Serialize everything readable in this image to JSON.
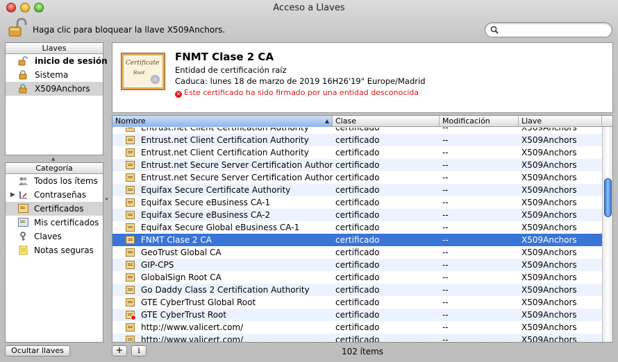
{
  "window": {
    "title": "Acceso a Llaves"
  },
  "toolbar": {
    "lock_text": "Haga clic para bloquear la llave X509Anchors.",
    "search_placeholder": ""
  },
  "keychains": {
    "header": "Llaves",
    "items": [
      {
        "label": "inicio de sesión",
        "icon": "unlocked-padlock-icon",
        "bold": true
      },
      {
        "label": "Sistema",
        "icon": "padlock-icon"
      },
      {
        "label": "X509Anchors",
        "icon": "padlock-icon",
        "selected": true
      }
    ]
  },
  "categories": {
    "header": "Categoría",
    "items": [
      {
        "label": "Todos los ítems",
        "icon": "people-icon"
      },
      {
        "label": "Contraseñas",
        "icon": "key-pen-icon",
        "expandable": true
      },
      {
        "label": "Certificados",
        "icon": "certificate-icon",
        "selected": true
      },
      {
        "label": "Mis certificados",
        "icon": "my-certificate-icon"
      },
      {
        "label": "Claves",
        "icon": "key-icon"
      },
      {
        "label": "Notas seguras",
        "icon": "note-icon"
      }
    ]
  },
  "detail": {
    "title": "FNMT Clase 2 CA",
    "subtitle": "Entidad de certificación raíz",
    "expires": "Caduca: lunes 18 de marzo de 2019 16H26'19\" Europe/Madrid",
    "error": "Este certificado ha sido firmado por una entidad desconocida",
    "thumb_word": "Certificate",
    "thumb_root": "Root"
  },
  "table": {
    "columns": [
      "Nombre",
      "Clase",
      "Modificación",
      "Llave"
    ],
    "rows": [
      {
        "name": "Entrust.net Client Certification Authority",
        "clase": "certificado",
        "mod": "--",
        "llave": "X509Anchors",
        "partial": true
      },
      {
        "name": "Entrust.net Client Certification Authority",
        "clase": "certificado",
        "mod": "--",
        "llave": "X509Anchors"
      },
      {
        "name": "Entrust.net Client Certification Authority",
        "clase": "certificado",
        "mod": "--",
        "llave": "X509Anchors"
      },
      {
        "name": "Entrust.net Secure Server Certification Authority",
        "clase": "certificado",
        "mod": "--",
        "llave": "X509Anchors"
      },
      {
        "name": "Entrust.net Secure Server Certification Authority",
        "clase": "certificado",
        "mod": "--",
        "llave": "X509Anchors"
      },
      {
        "name": "Equifax Secure Certificate Authority",
        "clase": "certificado",
        "mod": "--",
        "llave": "X509Anchors"
      },
      {
        "name": "Equifax Secure eBusiness CA-1",
        "clase": "certificado",
        "mod": "--",
        "llave": "X509Anchors"
      },
      {
        "name": "Equifax Secure eBusiness CA-2",
        "clase": "certificado",
        "mod": "--",
        "llave": "X509Anchors"
      },
      {
        "name": "Equifax Secure Global eBusiness CA-1",
        "clase": "certificado",
        "mod": "--",
        "llave": "X509Anchors"
      },
      {
        "name": "FNMT Clase 2 CA",
        "clase": "certificado",
        "mod": "--",
        "llave": "X509Anchors",
        "selected": true
      },
      {
        "name": "GeoTrust Global CA",
        "clase": "certificado",
        "mod": "--",
        "llave": "X509Anchors"
      },
      {
        "name": "GIP-CPS",
        "clase": "certificado",
        "mod": "--",
        "llave": "X509Anchors"
      },
      {
        "name": "GlobalSign Root CA",
        "clase": "certificado",
        "mod": "--",
        "llave": "X509Anchors"
      },
      {
        "name": "Go Daddy Class 2 Certification Authority",
        "clase": "certificado",
        "mod": "--",
        "llave": "X509Anchors"
      },
      {
        "name": "GTE CyberTrust Global Root",
        "clase": "certificado",
        "mod": "--",
        "llave": "X509Anchors"
      },
      {
        "name": "GTE CyberTrust Root",
        "clase": "certificado",
        "mod": "--",
        "llave": "X509Anchors",
        "invalid": true
      },
      {
        "name": "http://www.valicert.com/",
        "clase": "certificado",
        "mod": "--",
        "llave": "X509Anchors"
      },
      {
        "name": "http://www.valicert.com/",
        "clase": "certificado",
        "mod": "--",
        "llave": "X509Anchors"
      }
    ]
  },
  "bottom": {
    "hide_label": "Ocultar llaves",
    "plus_label": "+",
    "info_label": "i",
    "count": "102 ítems"
  },
  "colors": {
    "selection": "#3875d7",
    "error": "#e0181d",
    "alt_row": "#edf3fe"
  }
}
